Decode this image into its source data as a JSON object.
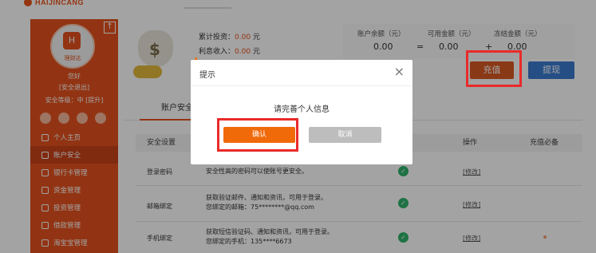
{
  "brand": {
    "name": "HAIJINCANG"
  },
  "sidebar": {
    "avatar_caption": "理财达",
    "greeting": "您好",
    "logout": "[安全退出]",
    "security_level": "安全等级：中 [提升]",
    "items": [
      {
        "label": "个人主页"
      },
      {
        "label": "账户安全"
      },
      {
        "label": "银行卡管理"
      },
      {
        "label": "资金管理"
      },
      {
        "label": "投资管理"
      },
      {
        "label": "借款管理"
      },
      {
        "label": "海宝宝管理"
      }
    ]
  },
  "summary": {
    "invest_label": "累计投资：",
    "invest_value": "0.00",
    "invest_unit": "元",
    "income_label": "利息收入：",
    "income_value": "0.00",
    "income_unit": "元"
  },
  "account": {
    "balance_label": "账户余额（元）",
    "available_label": "可用金额（元）",
    "frozen_label": "冻结金额（元）",
    "balance": "0.00",
    "eq": "=",
    "available": "0.00",
    "plus": "+",
    "frozen": "0.00"
  },
  "actions": {
    "charge": "充值",
    "withdraw": "提现"
  },
  "tabs": {
    "active": "账户安全"
  },
  "table": {
    "headers": {
      "setting": "安全设置",
      "op": "操作",
      "must": "充值必备"
    },
    "rows": [
      {
        "name": "登录密码",
        "desc": "安全性高的密码可以使账号更安全。",
        "desc2": "",
        "op": "[修改]"
      },
      {
        "name": "邮箱绑定",
        "desc": "获取验证邮件、通知和资讯，可用于登录。",
        "desc2": "您绑定的邮箱：75********@qq.com",
        "op": "[修改]"
      },
      {
        "name": "手机绑定",
        "desc": "获取短信验证码、通知和资讯，可用于登录。",
        "desc2": "您绑定的手机：135****6673",
        "op": "[修改]"
      }
    ]
  },
  "modal": {
    "title": "提示",
    "message": "请完善个人信息",
    "ok": "确认",
    "cancel": "取消",
    "close": "×"
  },
  "colors": {
    "accent": "#e5521f",
    "highlight": "#ea2a2a",
    "ok_button": "#f06a0a",
    "withdraw": "#3b7bd0"
  }
}
